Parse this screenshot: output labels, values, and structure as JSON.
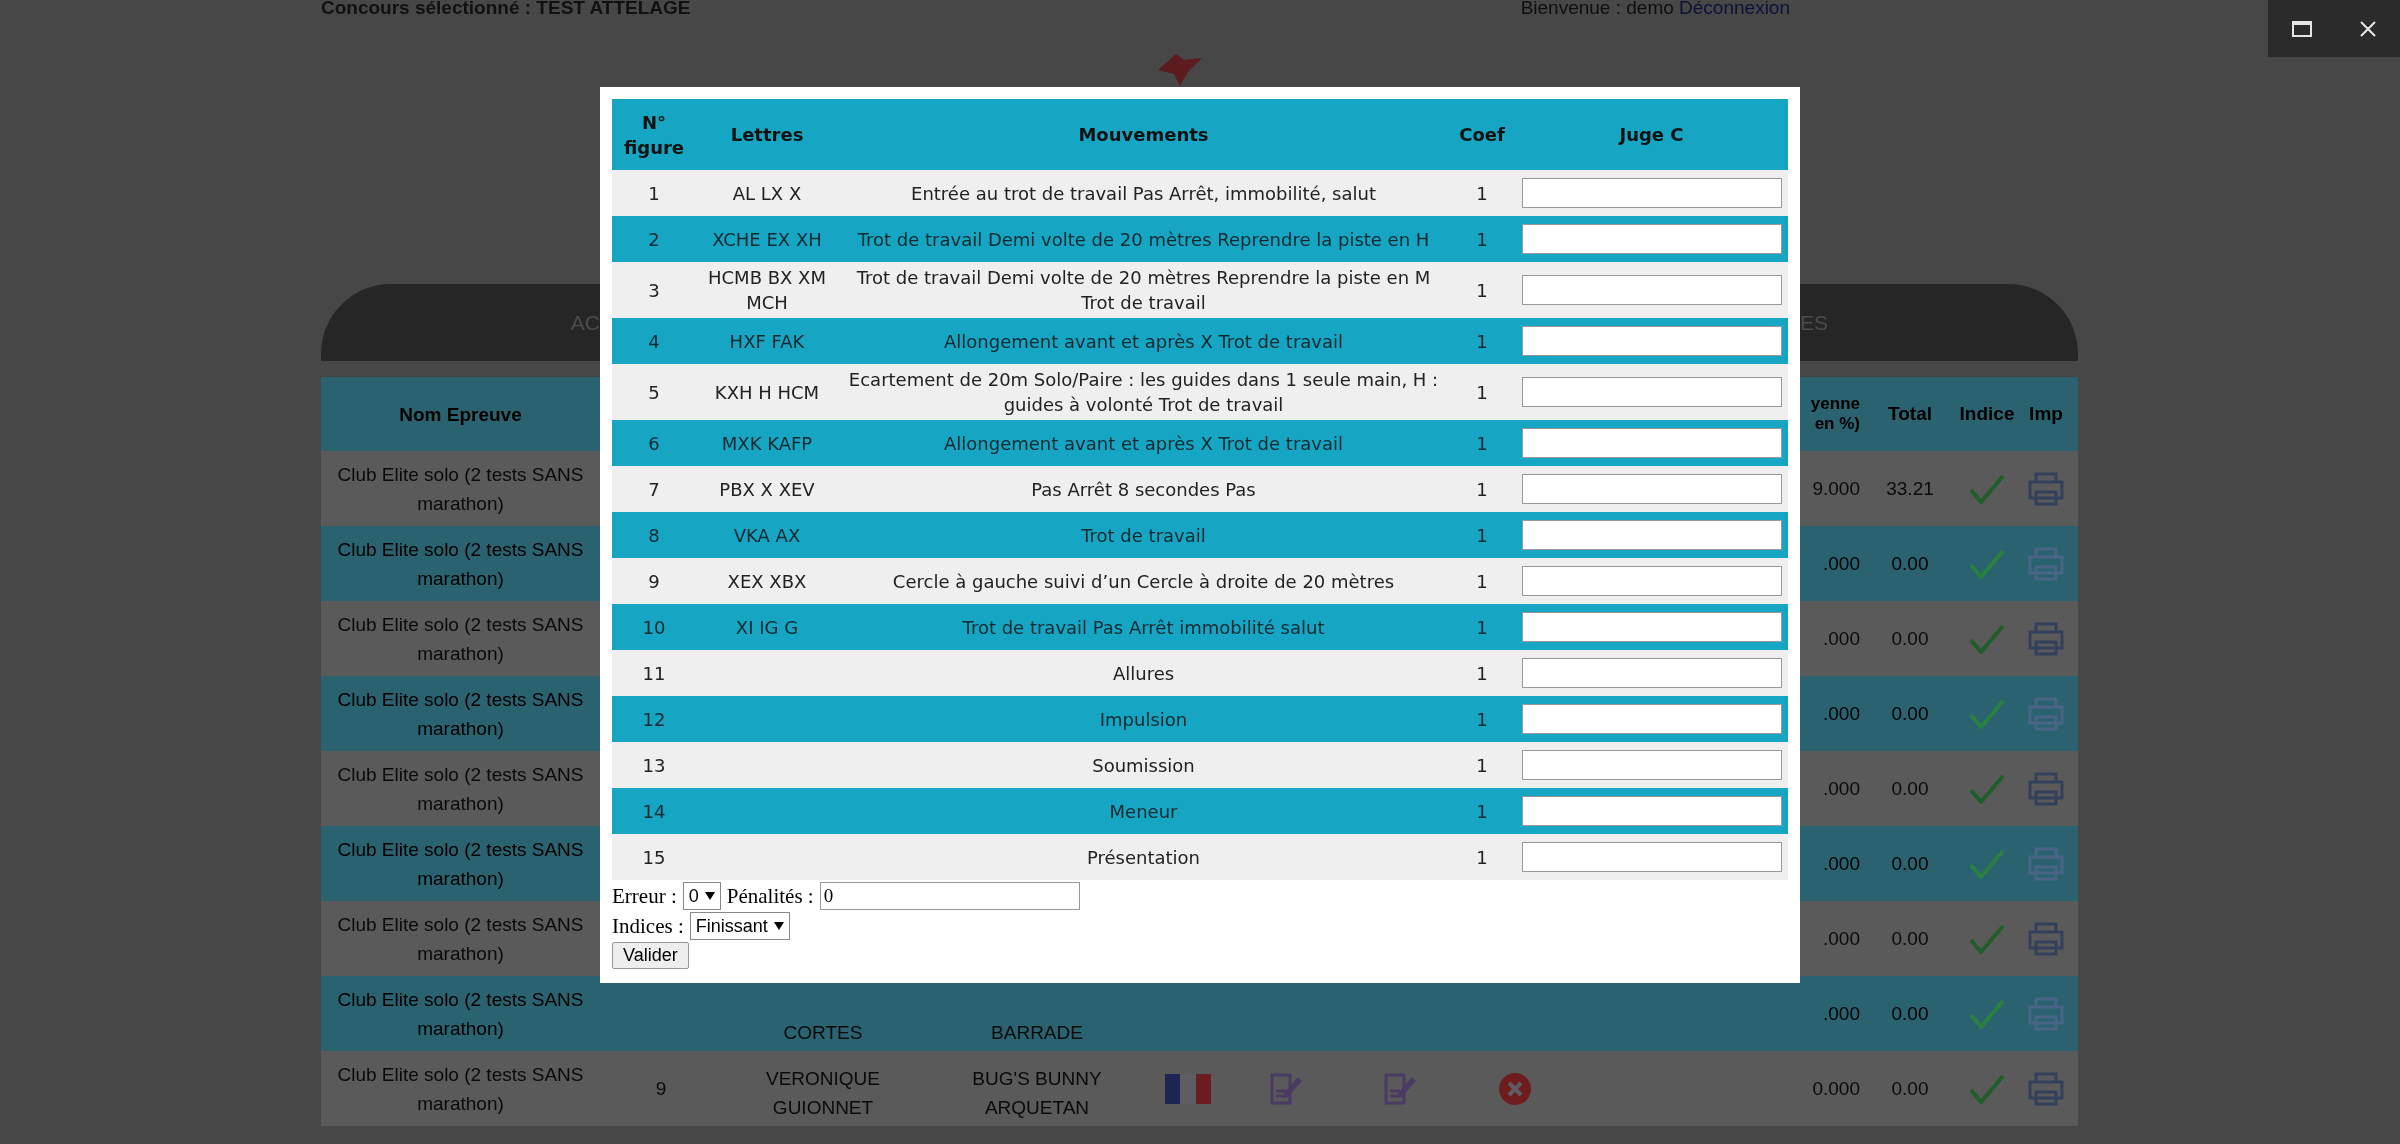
{
  "page": {
    "selected_contest": "Concours sélectionné : TEST ATTELAGE",
    "welcome": "Bienvenue : demo",
    "logout": "Déconnexion"
  },
  "tabs": [
    {
      "label": "AC"
    },
    {
      "label": "ES"
    }
  ],
  "results": {
    "columns": {
      "name": "Nom Epreuve",
      "average": "yenne en %)",
      "total": "Total",
      "index": "Indice",
      "print": "Imp"
    },
    "rows": [
      {
        "event": "Club Elite solo (2 tests SANS marathon)",
        "average": "9.000",
        "total": "33.21"
      },
      {
        "event": "Club Elite solo (2 tests SANS marathon)",
        "average": ".000",
        "total": "0.00"
      },
      {
        "event": "Club Elite solo (2 tests SANS marathon)",
        "average": ".000",
        "total": "0.00"
      },
      {
        "event": "Club Elite solo (2 tests SANS marathon)",
        "average": ".000",
        "total": "0.00"
      },
      {
        "event": "Club Elite solo (2 tests SANS marathon)",
        "average": ".000",
        "total": "0.00"
      },
      {
        "event": "Club Elite solo (2 tests SANS marathon)",
        "average": ".000",
        "total": "0.00"
      },
      {
        "event": "Club Elite solo (2 tests SANS marathon)",
        "average": ".000",
        "total": "0.00"
      },
      {
        "event": "Club Elite solo (2 tests SANS marathon)",
        "rider": "CORTES",
        "horse": "BARRADE",
        "average": ".000",
        "total": "0.00"
      },
      {
        "event": "Club Elite solo (2 tests SANS marathon)",
        "number": "9",
        "rider": "VERONIQUE GUIONNET",
        "horse": "BUG'S BUNNY ARQUETAN",
        "average": "0.000",
        "total": "0.00"
      }
    ]
  },
  "scoring_dialog": {
    "columns": {
      "number": "N° figure",
      "letters": "Lettres",
      "movement": "Mouvements",
      "coef": "Coef",
      "judge": "Juge C"
    },
    "figures": [
      {
        "number": "1",
        "letters": "AL LX X",
        "movement": "Entrée au trot de travail Pas Arrêt, immobilité, salut",
        "coef": "1"
      },
      {
        "number": "2",
        "letters": "XCHE EX XH",
        "movement": "Trot de travail Demi volte de 20 mètres Reprendre la piste en H",
        "coef": "1"
      },
      {
        "number": "3",
        "letters": "HCMB BX XM MCH",
        "movement": "Trot de travail Demi volte de 20 mètres Reprendre la piste en M Trot de travail",
        "coef": "1"
      },
      {
        "number": "4",
        "letters": "HXF FAK",
        "movement": "Allongement avant et après X Trot de travail",
        "coef": "1"
      },
      {
        "number": "5",
        "letters": "KXH H HCM",
        "movement": "Ecartement de 20m Solo/Paire : les guides dans 1 seule main, H : guides à volonté Trot de travail",
        "coef": "1"
      },
      {
        "number": "6",
        "letters": "MXK KAFP",
        "movement": "Allongement avant et après X Trot de travail",
        "coef": "1"
      },
      {
        "number": "7",
        "letters": "PBX X XEV",
        "movement": "Pas Arrêt 8 secondes Pas",
        "coef": "1"
      },
      {
        "number": "8",
        "letters": "VKA AX",
        "movement": "Trot de travail",
        "coef": "1"
      },
      {
        "number": "9",
        "letters": "XEX XBX",
        "movement": "Cercle à gauche suivi d’un Cercle à droite de 20 mètres",
        "coef": "1"
      },
      {
        "number": "10",
        "letters": "XI IG G",
        "movement": "Trot de travail Pas Arrêt immobilité salut",
        "coef": "1"
      },
      {
        "number": "11",
        "movement": "Allures",
        "coef": "1"
      },
      {
        "number": "12",
        "movement": "Impulsion",
        "coef": "1"
      },
      {
        "number": "13",
        "movement": "Soumission",
        "coef": "1"
      },
      {
        "number": "14",
        "movement": "Meneur",
        "coef": "1"
      },
      {
        "number": "15",
        "movement": "Présentation",
        "coef": "1"
      }
    ],
    "error": {
      "label": "Erreur :",
      "value": "0"
    },
    "penalties": {
      "label": "Pénalités :",
      "value": "0"
    },
    "indices": {
      "label": "Indices :",
      "value": "Finissant"
    },
    "submit": "Valider"
  }
}
